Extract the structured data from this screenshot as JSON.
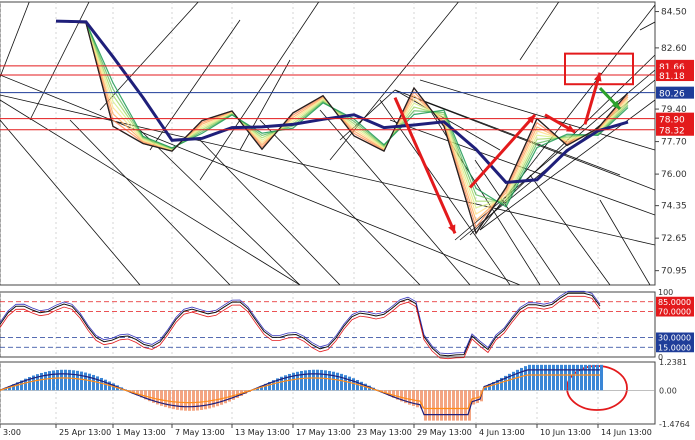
{
  "chart_data": {
    "type": "line",
    "main_panel": {
      "price_series": [
        [
          "25 Apr 13:00",
          84.0
        ],
        [
          "25 Apr 13:00",
          83.9
        ],
        [
          "1 May 13:00",
          78.5
        ],
        [
          "1 May 13:00",
          77.6
        ],
        [
          "7 May 13:00",
          77.2
        ],
        [
          "7 May 13:00",
          78.8
        ],
        [
          "13 May 13:00",
          79.3
        ],
        [
          "13 May 13:00",
          77.3
        ],
        [
          "17 May 13:00",
          79.2
        ],
        [
          "17 May 13:00",
          80.1
        ],
        [
          "23 May 13:00",
          78.0
        ],
        [
          "23 May 13:00",
          77.2
        ],
        [
          "29 May 13:00",
          80.5
        ],
        [
          "29 May 13:00",
          78.5
        ],
        [
          "4 Jun 13:00",
          72.9
        ],
        [
          "4 Jun 13:00",
          75.3
        ],
        [
          "10 Jun 13:00",
          78.9
        ],
        [
          "10 Jun 13:00",
          77.5
        ],
        [
          "14 Jun 13:00",
          78.4
        ],
        [
          "14 Jun 13:00",
          80.26
        ]
      ],
      "price_axis_ticks": [
        "84.50",
        "82.60",
        "79.40",
        "77.70",
        "76.00",
        "74.35",
        "72.65",
        "70.95"
      ],
      "level_labels": [
        {
          "text": "81.66",
          "color": "#e31a1c"
        },
        {
          "text": "81.18",
          "color": "#e31a1c"
        },
        {
          "text": "80.26",
          "color": "#1f3d99"
        },
        {
          "text": "78.90",
          "color": "#e31a1c"
        },
        {
          "text": "78.32",
          "color": "#e31a1c"
        }
      ]
    },
    "oscillator_panel": {
      "axis_labels": [
        {
          "text": "100",
          "color": "#333333"
        },
        {
          "text": "85.0000",
          "color": "#e31a1c"
        },
        {
          "text": "70.0000",
          "color": "#e31a1c"
        },
        {
          "text": "30.0000",
          "color": "#1f3d99"
        },
        {
          "text": "15.0000",
          "color": "#1f3d99"
        },
        {
          "text": "0",
          "color": "#333333"
        }
      ],
      "levels": [
        85,
        70,
        30,
        15
      ]
    },
    "histogram_panel": {
      "axis_labels": [
        "1.2381",
        "0.00",
        "-1.4764"
      ],
      "max": 1.2381,
      "min": -1.4764
    },
    "x_tick_labels": [
      "3:00",
      "25 Apr 13:00",
      "1 May 13:00",
      "7 May 13:00",
      "13 May 13:00",
      "17 May 13:00",
      "23 May 13:00",
      "29 May 13:00",
      "4 Jun 13:00",
      "10 Jun 13:00",
      "14 Jun 13:00"
    ],
    "annotations": {
      "arrows": [
        {
          "color": "#e31a1c",
          "direction": "down",
          "from": [
            "29 May 13:00",
            80.0
          ],
          "to": [
            "4 Jun 13:00",
            72.9
          ]
        },
        {
          "color": "#e31a1c",
          "direction": "up",
          "from": [
            "4 Jun 13:00",
            75.3
          ],
          "to": [
            "10 Jun 13:00",
            79.1
          ]
        },
        {
          "color": "#e31a1c",
          "direction": "down",
          "from": [
            "10 Jun 13:00",
            79.1
          ],
          "to": [
            "14 Jun 13:00",
            78.2
          ]
        },
        {
          "color": "#e31a1c",
          "direction": "up",
          "from": [
            "14 Jun 13:00",
            78.6
          ],
          "to": [
            "14 Jun 13:00",
            81.3
          ]
        },
        {
          "color": "#2ca02c",
          "direction": "down",
          "from": [
            "14 Jun 13:00",
            80.5
          ],
          "to": [
            "14 Jun 13:00",
            79.4
          ]
        }
      ],
      "highlight_box_color": "#e31a1c",
      "highlight_ellipse_color": "#e31a1c"
    }
  }
}
